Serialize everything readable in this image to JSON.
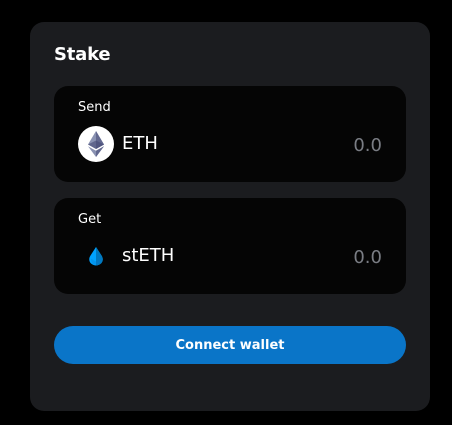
{
  "stake": {
    "title": "Stake",
    "send": {
      "label": "Send",
      "token": "ETH",
      "icon": "eth-logo-icon",
      "amount_placeholder": "0.0"
    },
    "get": {
      "label": "Get",
      "token": "stETH",
      "icon": "steth-drop-icon",
      "amount_placeholder": "0.0"
    },
    "connect_label": "Connect wallet"
  },
  "colors": {
    "background": "#000000",
    "card": "#1b1c1f",
    "box": "#050505",
    "accent": "#0a75c8",
    "muted_text": "#7a7d84"
  }
}
